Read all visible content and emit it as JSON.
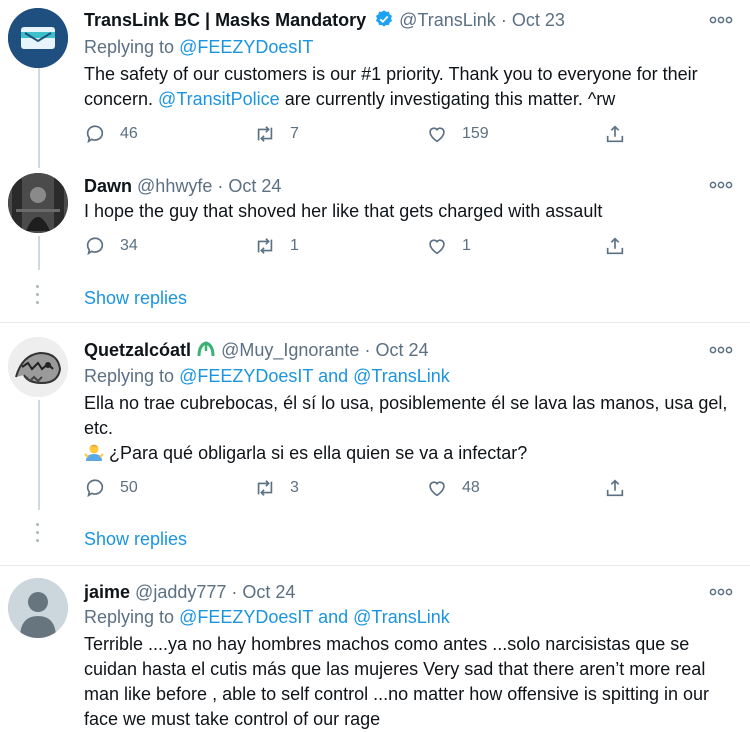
{
  "tweets": [
    {
      "name": "TransLink BC | Masks Mandatory",
      "handle": "@TransLink",
      "date": "Oct 23",
      "replying_label": "Replying to",
      "replying_to": "@FEEZYDoesIT",
      "text_before": "The safety of our customers is our #1 priority. Thank you to everyone for their concern. ",
      "mention": "@TransitPolice",
      "text_after": " are currently investigating this matter. ^rw",
      "replies": "46",
      "retweets": "7",
      "likes": "159"
    },
    {
      "name": "Dawn",
      "handle": "@hhwyfe",
      "date": "Oct 24",
      "text": "I hope the guy that shoved her like that gets charged with assault",
      "replies": "34",
      "retweets": "1",
      "likes": "1",
      "show_replies": "Show replies"
    },
    {
      "name": "Quetzalcóatl",
      "handle": "@Muy_Ignorante",
      "date": "Oct 24",
      "replying_label": "Replying to",
      "replying_to_1": "@FEEZYDoesIT",
      "replying_and": "and",
      "replying_to_2": "@TransLink",
      "text_line1": "Ella no trae cubrebocas, él sí lo usa, posiblemente él se lava las manos, usa gel, etc.",
      "text_line2": "¿Para qué obligarla si es ella quien se va a infectar?",
      "replies": "50",
      "retweets": "3",
      "likes": "48",
      "show_replies": "Show replies"
    },
    {
      "name": "jaime",
      "handle": "@jaddy777",
      "date": "Oct 24",
      "replying_label": "Replying to",
      "replying_to_1": "@FEEZYDoesIT",
      "replying_and": "and",
      "replying_to_2": "@TransLink",
      "text": "Terrible ....ya no hay hombres machos como antes ...solo narcisistas que se cuidan hasta el cutis más que las mujeres  Very sad that there aren’t more real man like before , able to self control ...no matter how offensive is spitting in our face we must take control of our rage"
    }
  ],
  "dot_separator": "·",
  "colors": {
    "link": "#1b95e0",
    "muted": "#5b7083",
    "verified": "#1da1f2",
    "divider": "#e6ecf0"
  }
}
